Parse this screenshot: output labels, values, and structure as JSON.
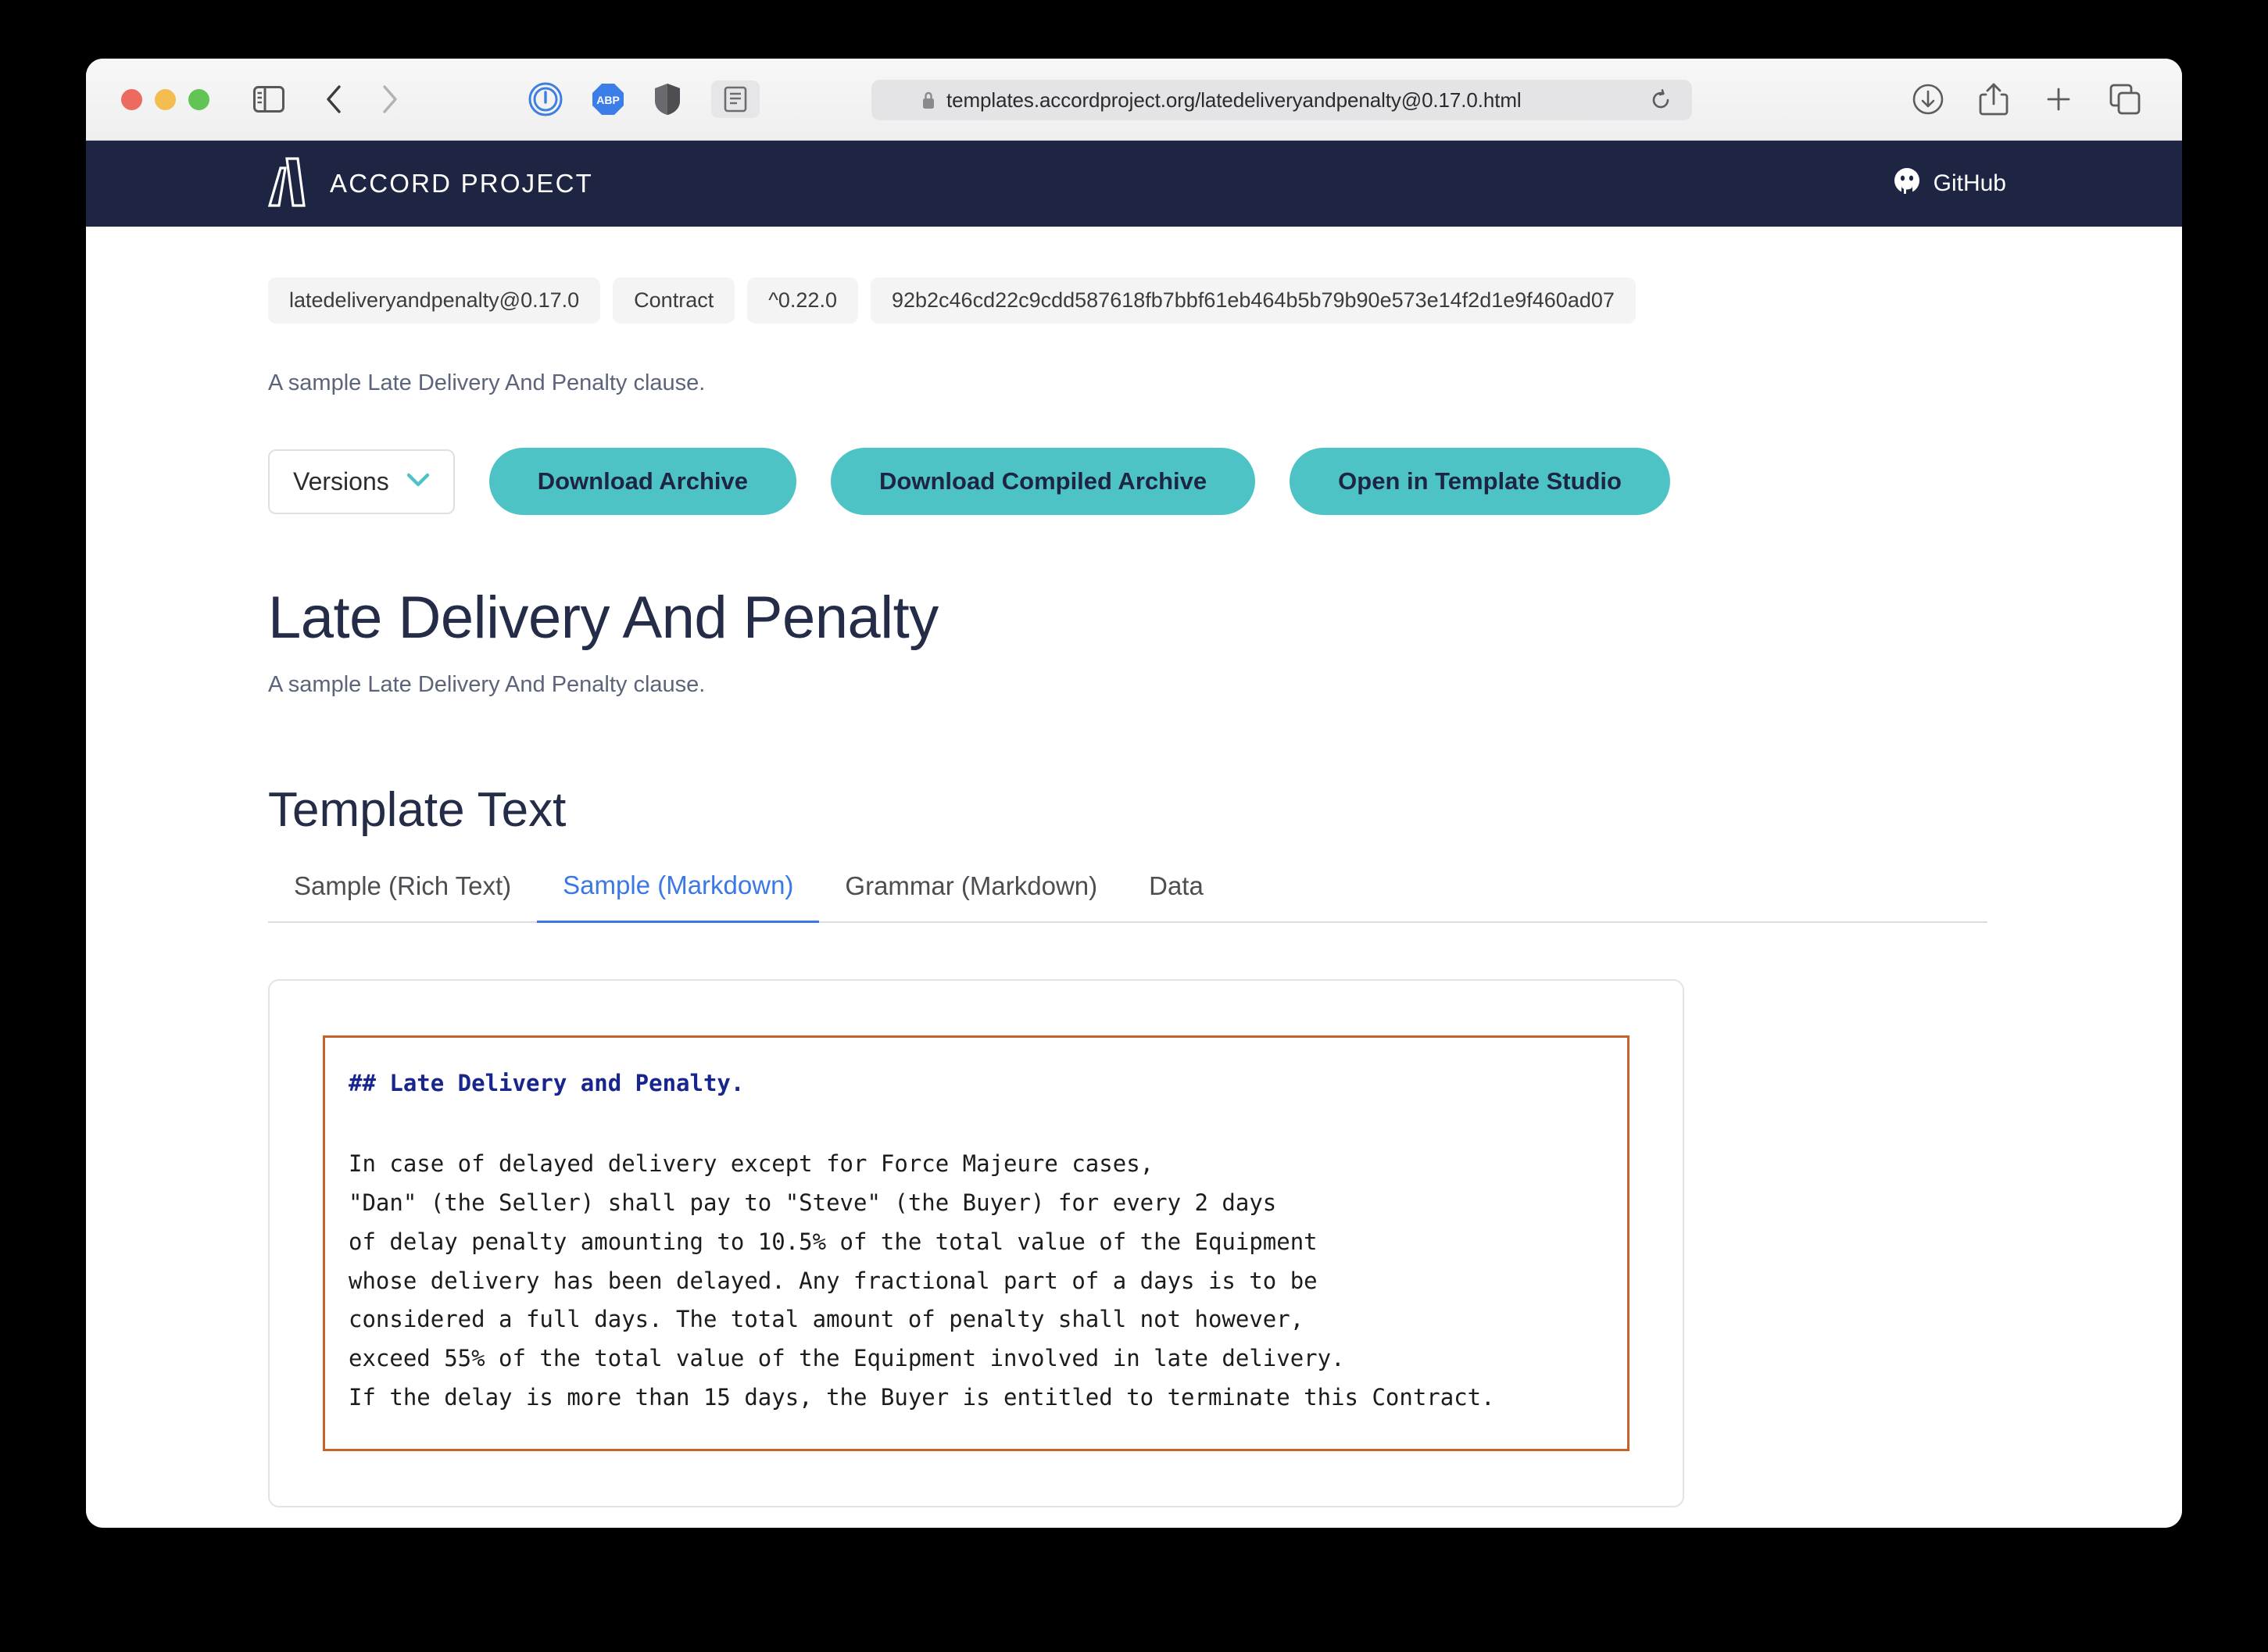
{
  "browser": {
    "url": "templates.accordproject.org/latedeliveryandpenalty@0.17.0.html",
    "icons": {
      "sidebar": "sidebar-icon",
      "back": "back-arrow-icon",
      "forward": "forward-arrow-icon",
      "onepassword": "1password-extension-icon",
      "adblock": "ABP",
      "shield": "privacy-shield-icon",
      "reader": "reader-view-icon",
      "lock": "lock-icon",
      "reload": "reload-icon",
      "downloads": "downloads-icon",
      "share": "share-icon",
      "newtab": "new-tab-icon",
      "tabs": "tab-overview-icon"
    }
  },
  "site_header": {
    "brand": "ACCORD PROJECT",
    "github_label": "GitHub"
  },
  "meta_badges": [
    "latedeliveryandpenalty@0.17.0",
    "Contract",
    "^0.22.0",
    "92b2c46cd22c9cdd587618fb7bbf61eb464b5b79b90e573e14f2d1e9f460ad07"
  ],
  "short_description": "A sample Late Delivery And Penalty clause.",
  "actions": {
    "versions_label": "Versions",
    "download_archive": "Download Archive",
    "download_compiled_archive": "Download Compiled Archive",
    "open_in_template_studio": "Open in Template Studio"
  },
  "template": {
    "title": "Late Delivery And Penalty",
    "description": "A sample Late Delivery And Penalty clause."
  },
  "section": {
    "title": "Template Text",
    "tabs": [
      {
        "label": "Sample (Rich Text)",
        "active": false
      },
      {
        "label": "Sample (Markdown)",
        "active": true
      },
      {
        "label": "Grammar (Markdown)",
        "active": false
      },
      {
        "label": "Data",
        "active": false
      }
    ]
  },
  "code": {
    "heading": "## Late Delivery and Penalty.",
    "body": "In case of delayed delivery except for Force Majeure cases,\n\"Dan\" (the Seller) shall pay to \"Steve\" (the Buyer) for every 2 days\nof delay penalty amounting to 10.5% of the total value of the Equipment\nwhose delivery has been delayed. Any fractional part of a days is to be\nconsidered a full days. The total amount of penalty shall not however,\nexceed 55% of the total value of the Equipment involved in late delivery.\nIf the delay is more than 15 days, the Buyer is entitled to terminate this Contract."
  },
  "colors": {
    "header_navy": "#1d2542",
    "accent_teal": "#4ec3c5",
    "active_tab_blue": "#3b78e7",
    "code_border_orange": "#c8612a",
    "code_heading_blue": "#17258c"
  }
}
